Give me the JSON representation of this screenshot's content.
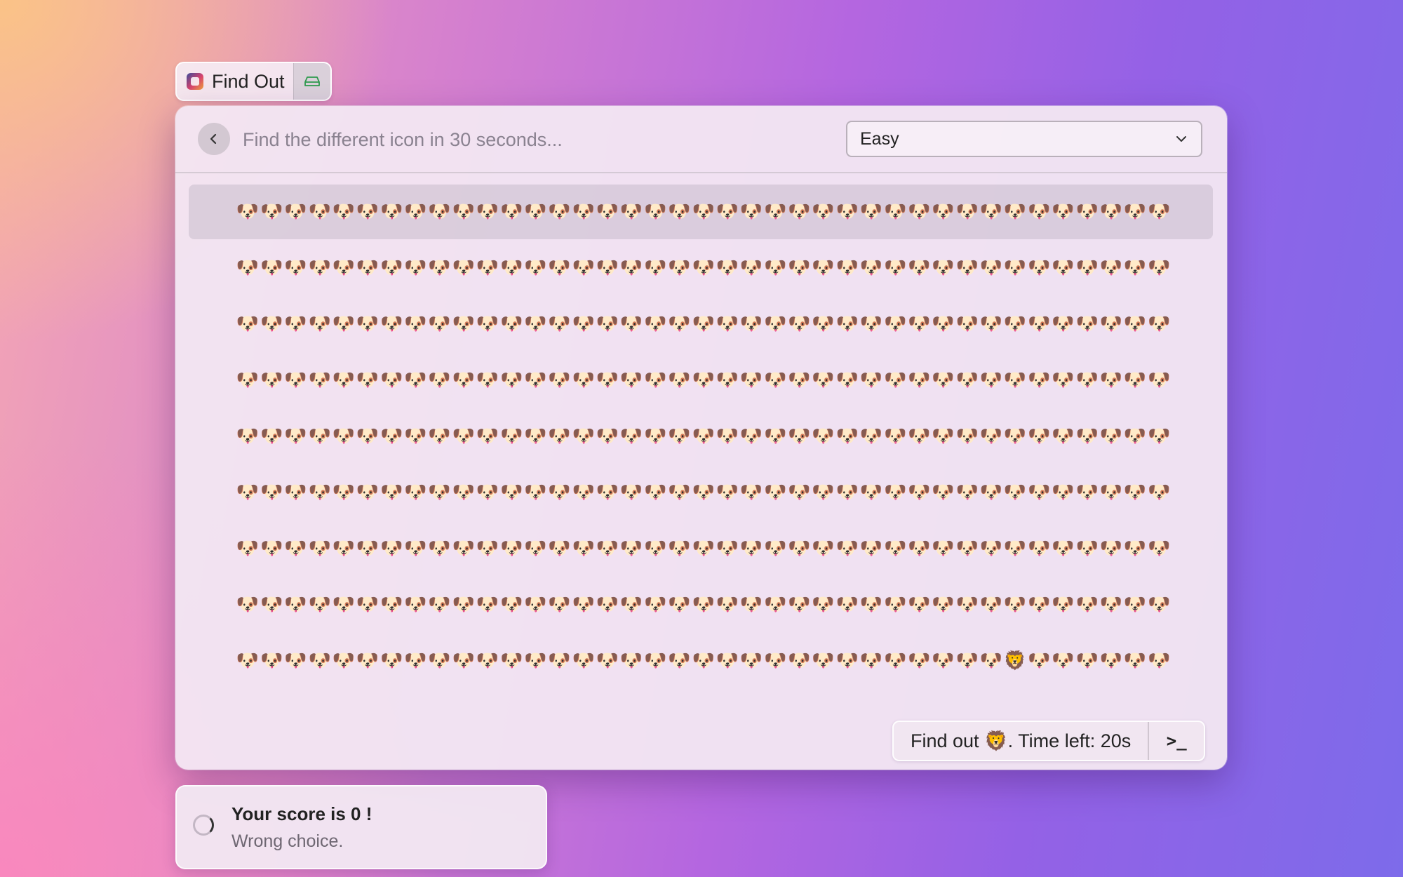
{
  "tab": {
    "title": "Find Out"
  },
  "header": {
    "search_placeholder": "Find the different icon in 30 seconds...",
    "difficulty_selected": "Easy"
  },
  "grid": {
    "base_icon": "🐶",
    "odd_icon": "🦁",
    "columns": 39,
    "rows": [
      {
        "odd_index": -1
      },
      {
        "odd_index": -1
      },
      {
        "odd_index": -1
      },
      {
        "odd_index": -1
      },
      {
        "odd_index": -1
      },
      {
        "odd_index": -1
      },
      {
        "odd_index": -1
      },
      {
        "odd_index": -1
      },
      {
        "odd_index": 32
      }
    ],
    "selected_row": 0
  },
  "action_bar": {
    "primary_label": "Find out 🦁. Time left: 20s",
    "secondary_label": ">_"
  },
  "toast": {
    "title": "Your score is 0 !",
    "message": "Wrong choice."
  },
  "icons": {
    "back": "chevron-left-icon",
    "dropdown": "chevron-down-icon",
    "app": "app-icon",
    "tab_side": "hard-drive-icon",
    "toast": "spinner-icon",
    "action": "terminal-icon"
  }
}
